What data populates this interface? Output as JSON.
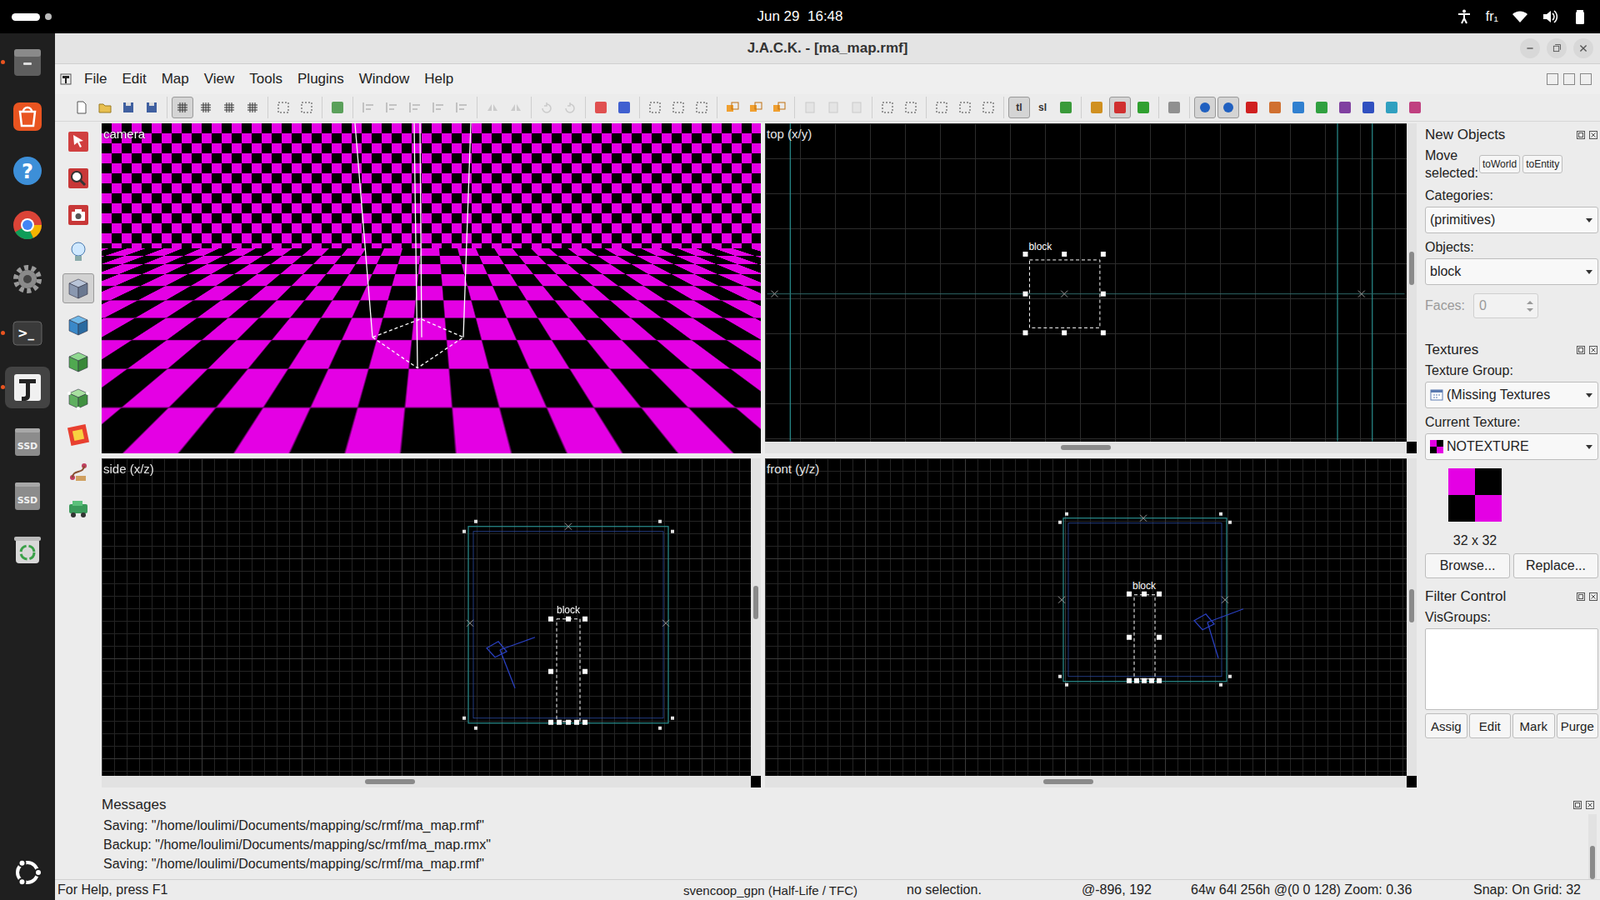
{
  "topbar": {
    "clock": "Jun 29  16:48",
    "keyboard": "fr₁"
  },
  "dock": [
    {
      "kind": "files",
      "label": "",
      "running": true,
      "selected": false
    },
    {
      "kind": "appstore",
      "label": "",
      "running": false,
      "selected": false
    },
    {
      "kind": "help",
      "label": "?",
      "running": false,
      "selected": false
    },
    {
      "kind": "chrome",
      "label": "",
      "running": false,
      "selected": false
    },
    {
      "kind": "settings",
      "label": "",
      "running": false,
      "selected": false
    },
    {
      "kind": "terminal",
      "label": ">_",
      "running": true,
      "selected": false
    },
    {
      "kind": "jack",
      "label": "",
      "running": true,
      "selected": true
    },
    {
      "kind": "drive",
      "label": "SSD",
      "running": false,
      "selected": false
    },
    {
      "kind": "drive",
      "label": "SSD",
      "running": false,
      "selected": false
    },
    {
      "kind": "trash",
      "label": "",
      "running": false,
      "selected": false
    }
  ],
  "window": {
    "title": "J.A.C.K. - [ma_map.rmf]"
  },
  "menu": [
    "File",
    "Edit",
    "Map",
    "View",
    "Tools",
    "Plugins",
    "Window",
    "Help"
  ],
  "toolbar": [
    [
      {
        "kind": "doc",
        "pressed": false,
        "disabled": false
      },
      {
        "kind": "folder",
        "pressed": false,
        "disabled": false
      },
      {
        "kind": "disk",
        "pressed": false,
        "disabled": false
      },
      {
        "kind": "disk",
        "pressed": false,
        "disabled": false
      }
    ],
    [
      {
        "kind": "grid",
        "pressed": true,
        "disabled": false
      },
      {
        "kind": "grid",
        "pressed": false,
        "disabled": false
      },
      {
        "kind": "grid",
        "pressed": false,
        "disabled": false
      },
      {
        "kind": "grid",
        "pressed": false,
        "disabled": false
      }
    ],
    [
      {
        "kind": "sel",
        "pressed": false,
        "disabled": false
      },
      {
        "kind": "sel",
        "pressed": false,
        "disabled": false
      }
    ],
    [
      {
        "kind": "badge",
        "color": "#5aa05a",
        "pressed": false,
        "disabled": false
      }
    ],
    [
      {
        "kind": "align",
        "pressed": false,
        "disabled": true
      },
      {
        "kind": "align",
        "pressed": false,
        "disabled": true
      },
      {
        "kind": "align",
        "pressed": false,
        "disabled": true
      },
      {
        "kind": "align",
        "pressed": false,
        "disabled": true
      },
      {
        "kind": "align",
        "pressed": false,
        "disabled": true
      }
    ],
    [
      {
        "kind": "flip",
        "pressed": false,
        "disabled": true
      },
      {
        "kind": "flip",
        "pressed": false,
        "disabled": true
      }
    ],
    [
      {
        "kind": "rotate",
        "pressed": false,
        "disabled": true
      },
      {
        "kind": "rotate",
        "pressed": false,
        "disabled": true
      }
    ],
    [
      {
        "kind": "badge",
        "color": "#e05050",
        "pressed": false,
        "disabled": false
      },
      {
        "kind": "badge",
        "color": "#4060d0",
        "pressed": false,
        "disabled": false
      }
    ],
    [
      {
        "kind": "sel",
        "pressed": false,
        "disabled": false
      },
      {
        "kind": "sel",
        "pressed": false,
        "disabled": false
      },
      {
        "kind": "sel",
        "pressed": false,
        "disabled": false
      }
    ],
    [
      {
        "kind": "group",
        "pressed": false,
        "disabled": false
      },
      {
        "kind": "group",
        "pressed": false,
        "disabled": false
      },
      {
        "kind": "group",
        "pressed": false,
        "disabled": false
      }
    ],
    [
      {
        "kind": "clip",
        "pressed": false,
        "disabled": true
      },
      {
        "kind": "clip",
        "pressed": false,
        "disabled": true
      },
      {
        "kind": "clip",
        "pressed": false,
        "disabled": true
      }
    ],
    [
      {
        "kind": "sel",
        "pressed": false,
        "disabled": false
      },
      {
        "kind": "sel",
        "pressed": false,
        "disabled": false
      }
    ],
    [
      {
        "kind": "sel",
        "pressed": false,
        "disabled": false
      },
      {
        "kind": "sel",
        "pressed": false,
        "disabled": false
      },
      {
        "kind": "sel",
        "pressed": false,
        "disabled": false
      }
    ],
    [
      {
        "kind": "text",
        "label": "tl",
        "pressed": true,
        "disabled": false
      },
      {
        "kind": "text",
        "label": "sl",
        "pressed": false,
        "disabled": false
      },
      {
        "kind": "badge",
        "color": "#3a9a3a",
        "pressed": false,
        "disabled": false
      }
    ],
    [
      {
        "kind": "badge",
        "color": "#d09020",
        "pressed": false,
        "disabled": false
      },
      {
        "kind": "badge",
        "color": "#d03030",
        "pressed": true,
        "disabled": false
      },
      {
        "kind": "badge",
        "color": "#30a030",
        "pressed": false,
        "disabled": false
      }
    ],
    [
      {
        "kind": "badge",
        "color": "#909090",
        "pressed": false,
        "disabled": false
      }
    ],
    [
      {
        "kind": "dot",
        "color": "#2060c0",
        "pressed": true,
        "disabled": false
      },
      {
        "kind": "dot",
        "color": "#2060c0",
        "pressed": true,
        "disabled": false
      },
      {
        "kind": "badge",
        "color": "#d02020",
        "pressed": false,
        "disabled": false
      },
      {
        "kind": "badge",
        "color": "#d07030",
        "pressed": false,
        "disabled": false
      },
      {
        "kind": "badge",
        "color": "#3080d0",
        "pressed": false,
        "disabled": false
      },
      {
        "kind": "badge",
        "color": "#30a040",
        "pressed": false,
        "disabled": false
      },
      {
        "kind": "badge",
        "color": "#8040a0",
        "pressed": false,
        "disabled": false
      },
      {
        "kind": "badge",
        "color": "#3050c0",
        "pressed": false,
        "disabled": false
      },
      {
        "kind": "badge",
        "color": "#30a0c0",
        "pressed": false,
        "disabled": false
      },
      {
        "kind": "badge",
        "color": "#c04080",
        "pressed": false,
        "disabled": false
      }
    ]
  ],
  "tools": [
    {
      "kind": "select",
      "selected": false
    },
    {
      "kind": "zoom",
      "selected": false
    },
    {
      "kind": "camera",
      "selected": false
    },
    {
      "kind": "entity",
      "selected": false
    },
    {
      "kind": "block",
      "selected": true
    },
    {
      "kind": "texture",
      "selected": false
    },
    {
      "kind": "apply",
      "selected": false
    },
    {
      "kind": "vertex",
      "selected": false
    },
    {
      "kind": "decal",
      "selected": false
    },
    {
      "kind": "path",
      "selected": false
    },
    {
      "kind": "overlay",
      "selected": false
    }
  ],
  "viewports": [
    {
      "kind": "camera",
      "label": "camera"
    },
    {
      "kind": "top",
      "label": "top (x/y)",
      "object": "block",
      "hscroll": 0.5,
      "vscroll": 0.45
    },
    {
      "kind": "side",
      "label": "side (x/z)",
      "object": "block",
      "hscroll": 0.44,
      "vscroll": 0.45
    },
    {
      "kind": "front",
      "label": "front (y/z)",
      "object": "block",
      "hscroll": 0.47,
      "vscroll": 0.46
    }
  ],
  "panel": {
    "new_objects": {
      "title": "New Objects",
      "move_label": "Move selected:",
      "move_buttons": [
        "toWorld",
        "toEntity"
      ],
      "categories_label": "Categories:",
      "category": "(primitives)",
      "objects_label": "Objects:",
      "object": "block",
      "faces_label": "Faces:",
      "faces": "0",
      "faces_disabled": true
    },
    "textures": {
      "title": "Textures",
      "group_label": "Texture Group:",
      "group": "(Missing Textures",
      "current_label": "Current Texture:",
      "current": "NOTEXTURE",
      "size": "32 x 32",
      "buttons": [
        "Browse...",
        "Replace..."
      ]
    },
    "filter": {
      "title": "Filter Control",
      "visgroups_label": "VisGroups:",
      "visgroups": [],
      "buttons": [
        "Assig",
        "Edit",
        "Mark",
        "Purge"
      ]
    }
  },
  "messages": {
    "title": "Messages",
    "scroll": 1,
    "lines": [
      "Saving: \"/home/loulimi/Documents/mapping/sc/rmf/ma_map.rmf\"",
      "Backup: \"/home/loulimi/Documents/mapping/sc/rmf/ma_map.rmx\"",
      "Saving: \"/home/loulimi/Documents/mapping/sc/rmf/ma_map.rmf\""
    ]
  },
  "status": {
    "help": "For Help, press F1",
    "game": "svencoop_gpn (Half-Life / TFC)",
    "selection": "no selection.",
    "cursor": "@-896, 192",
    "size": "64w 64l 256h @(0 0 128) Zoom: 0.36",
    "snap": "Snap: On Grid: 32"
  }
}
